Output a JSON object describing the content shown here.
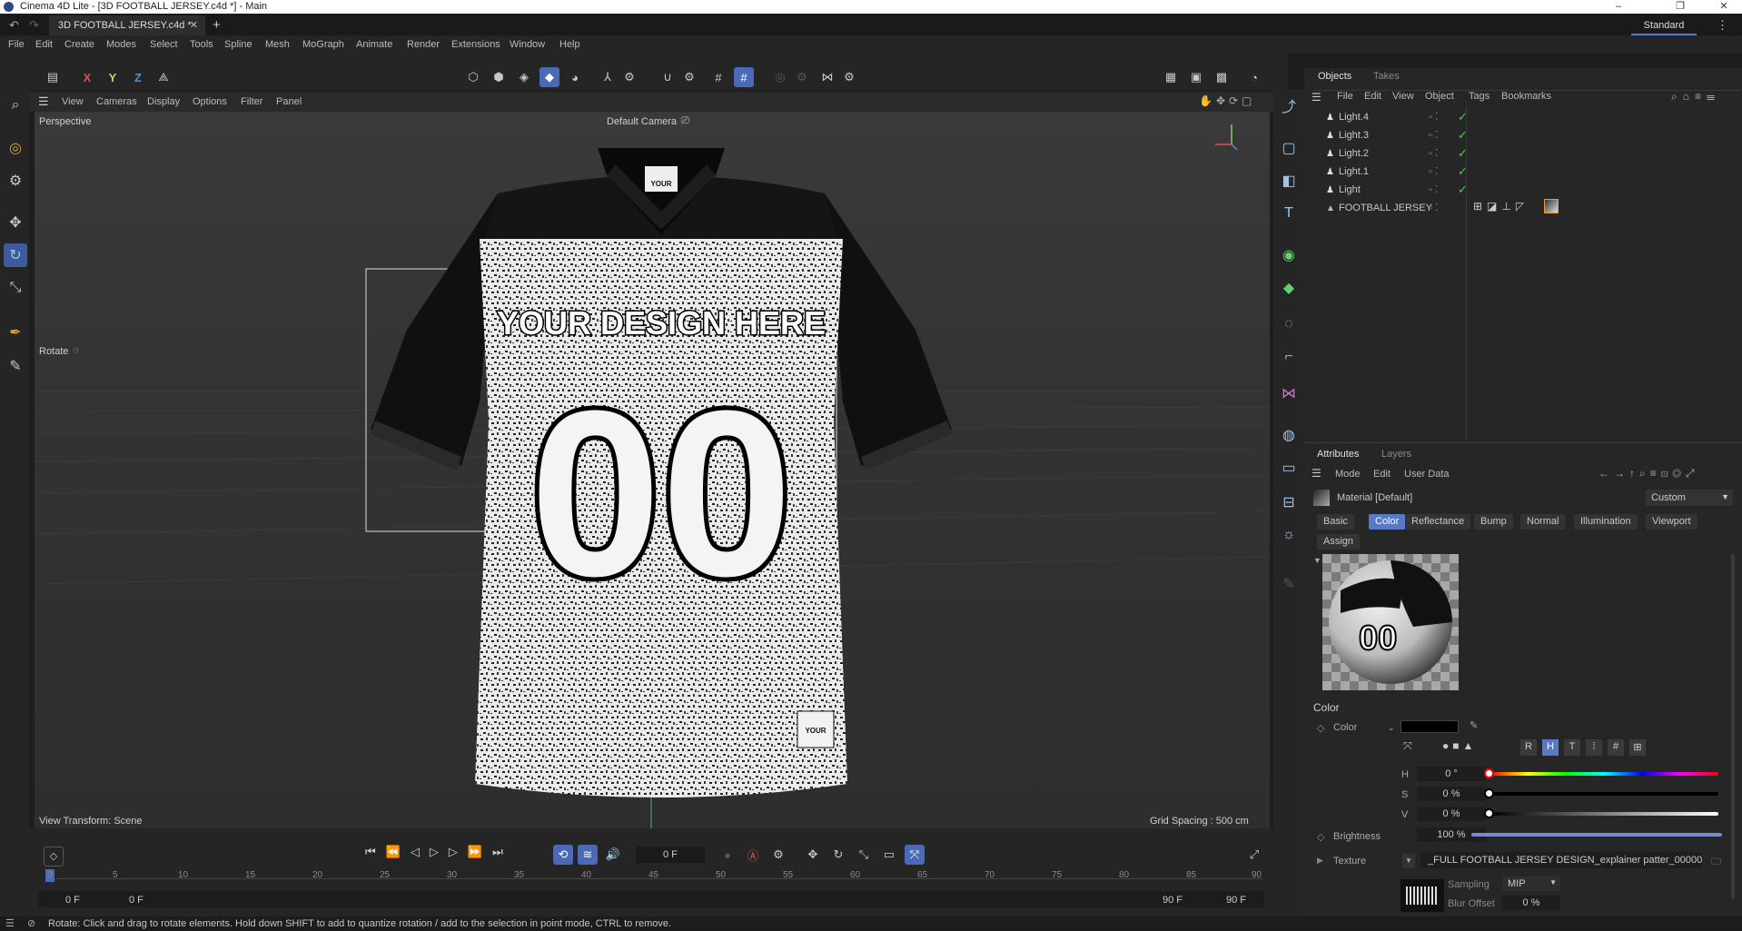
{
  "window": {
    "title": "Cinema 4D Lite - [3D FOOTBALL JERSEY.c4d *] - Main",
    "controls": [
      "–",
      "❐",
      "✕"
    ]
  },
  "tabs": {
    "document": "3D FOOTBALL JERSEY.c4d *",
    "layout": "Standard"
  },
  "menu": [
    "File",
    "Edit",
    "Create",
    "Modes",
    "Select",
    "Tools",
    "Spline",
    "Mesh",
    "MoGraph",
    "Animate",
    "Render",
    "Extensions",
    "Window",
    "Help"
  ],
  "toolbar": {
    "axis_x": "X",
    "axis_y": "Y",
    "axis_z": "Z"
  },
  "viewport": {
    "menu": [
      "View",
      "Cameras",
      "Display",
      "Options",
      "Filter",
      "Panel"
    ],
    "name": "Perspective",
    "camera": "Default Camera",
    "tool_label": "Rotate",
    "view_transform": "View Transform: Scene",
    "grid_spacing": "Grid Spacing : 500 cm",
    "jersey_text": "YOUR DESIGN HERE",
    "jersey_number": "00",
    "tag_text": "YOUR DESIGN HERE"
  },
  "objects_panel": {
    "tabs": [
      "Objects",
      "Takes"
    ],
    "menu": [
      "File",
      "Edit",
      "View",
      "Object",
      "Tags",
      "Bookmarks"
    ],
    "items": [
      {
        "name": "Light.4"
      },
      {
        "name": "Light.3"
      },
      {
        "name": "Light.2"
      },
      {
        "name": "Light.1"
      },
      {
        "name": "Light"
      },
      {
        "name": "FOOTBALL JERSEY"
      }
    ]
  },
  "attributes_panel": {
    "tabs": [
      "Attributes",
      "Layers"
    ],
    "menu": [
      "Mode",
      "Edit",
      "User Data"
    ],
    "material_label": "Material [Default]",
    "preset": "Custom",
    "channel_tabs": [
      "Basic",
      "Color",
      "Reflectance",
      "Bump",
      "Normal",
      "Illumination",
      "Viewport",
      "Assign"
    ],
    "active_channel": "Color",
    "section": "Color",
    "color_label": "Color",
    "color_swatch": "#000000",
    "mode_buttons": [
      "R",
      "H",
      "T",
      "⁞",
      "#",
      "⊞"
    ],
    "h_label": "H",
    "h_value": "0 °",
    "s_label": "S",
    "s_value": "0 %",
    "v_label": "V",
    "v_value": "0 %",
    "brightness_label": "Brightness",
    "brightness_value": "100 %",
    "texture_label": "Texture",
    "texture_file": "_FULL FOOTBALL JERSEY DESIGN_explainer patter_00000.png",
    "sampling_label": "Sampling",
    "sampling_value": "MIP",
    "blur_label": "Blur Offset",
    "blur_value": "0 %"
  },
  "timeline": {
    "current_frame": "0 F",
    "ticks": [
      "0",
      "5",
      "10",
      "15",
      "20",
      "25",
      "30",
      "35",
      "40",
      "45",
      "50",
      "55",
      "60",
      "65",
      "70",
      "75",
      "80",
      "85",
      "90"
    ],
    "start_a": "0 F",
    "start_b": "0 F",
    "end_a": "90 F",
    "end_b": "90 F"
  },
  "status": "Rotate: Click and drag to rotate elements. Hold down SHIFT to add to quantize rotation / add to the selection in point mode, CTRL to remove.",
  "colors": {
    "accent": "#4a6ab8",
    "check": "#4fcf4f",
    "axis_x": "#e05050",
    "axis_y": "#d8c850",
    "axis_z": "#4f8fe0"
  }
}
